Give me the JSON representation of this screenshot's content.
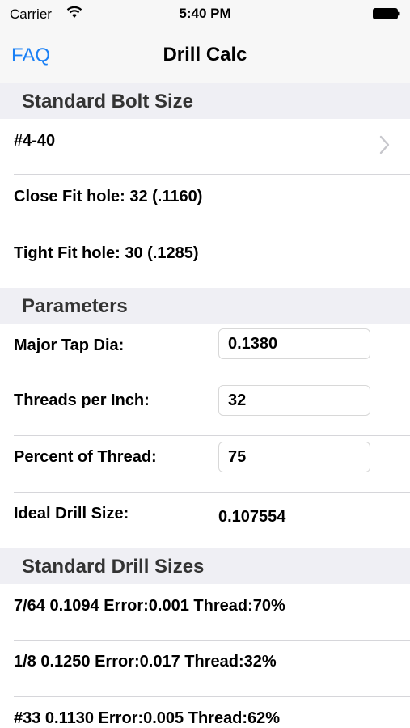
{
  "status": {
    "carrier": "Carrier",
    "time": "5:40 PM"
  },
  "nav": {
    "faq": "FAQ",
    "title": "Drill Calc"
  },
  "standard_bolt": {
    "header": "Standard Bolt Size",
    "size": "#4-40",
    "close_fit": "Close Fit hole: 32 (.1160)",
    "tight_fit": "Tight Fit hole: 30 (.1285)"
  },
  "parameters": {
    "header": "Parameters",
    "major_tap_label": "Major Tap Dia:",
    "major_tap_value": "0.1380",
    "threads_label": "Threads per Inch:",
    "threads_value": "32",
    "percent_label": "Percent of Thread:",
    "percent_value": "75",
    "ideal_label": "Ideal Drill Size:",
    "ideal_value": "0.107554"
  },
  "drills": {
    "header": "Standard Drill Sizes",
    "items": [
      "7/64 0.1094 Error:0.001 Thread:70%",
      "1/8 0.1250 Error:0.017 Thread:32%",
      "#33 0.1130 Error:0.005 Thread:62%"
    ]
  },
  "colors": {
    "accent": "#1a80f5",
    "section_bg": "#efeff4",
    "nav_bg": "#f7f7f7"
  },
  "icons": [
    "wifi-icon",
    "battery-icon",
    "chevron-right-icon"
  ]
}
